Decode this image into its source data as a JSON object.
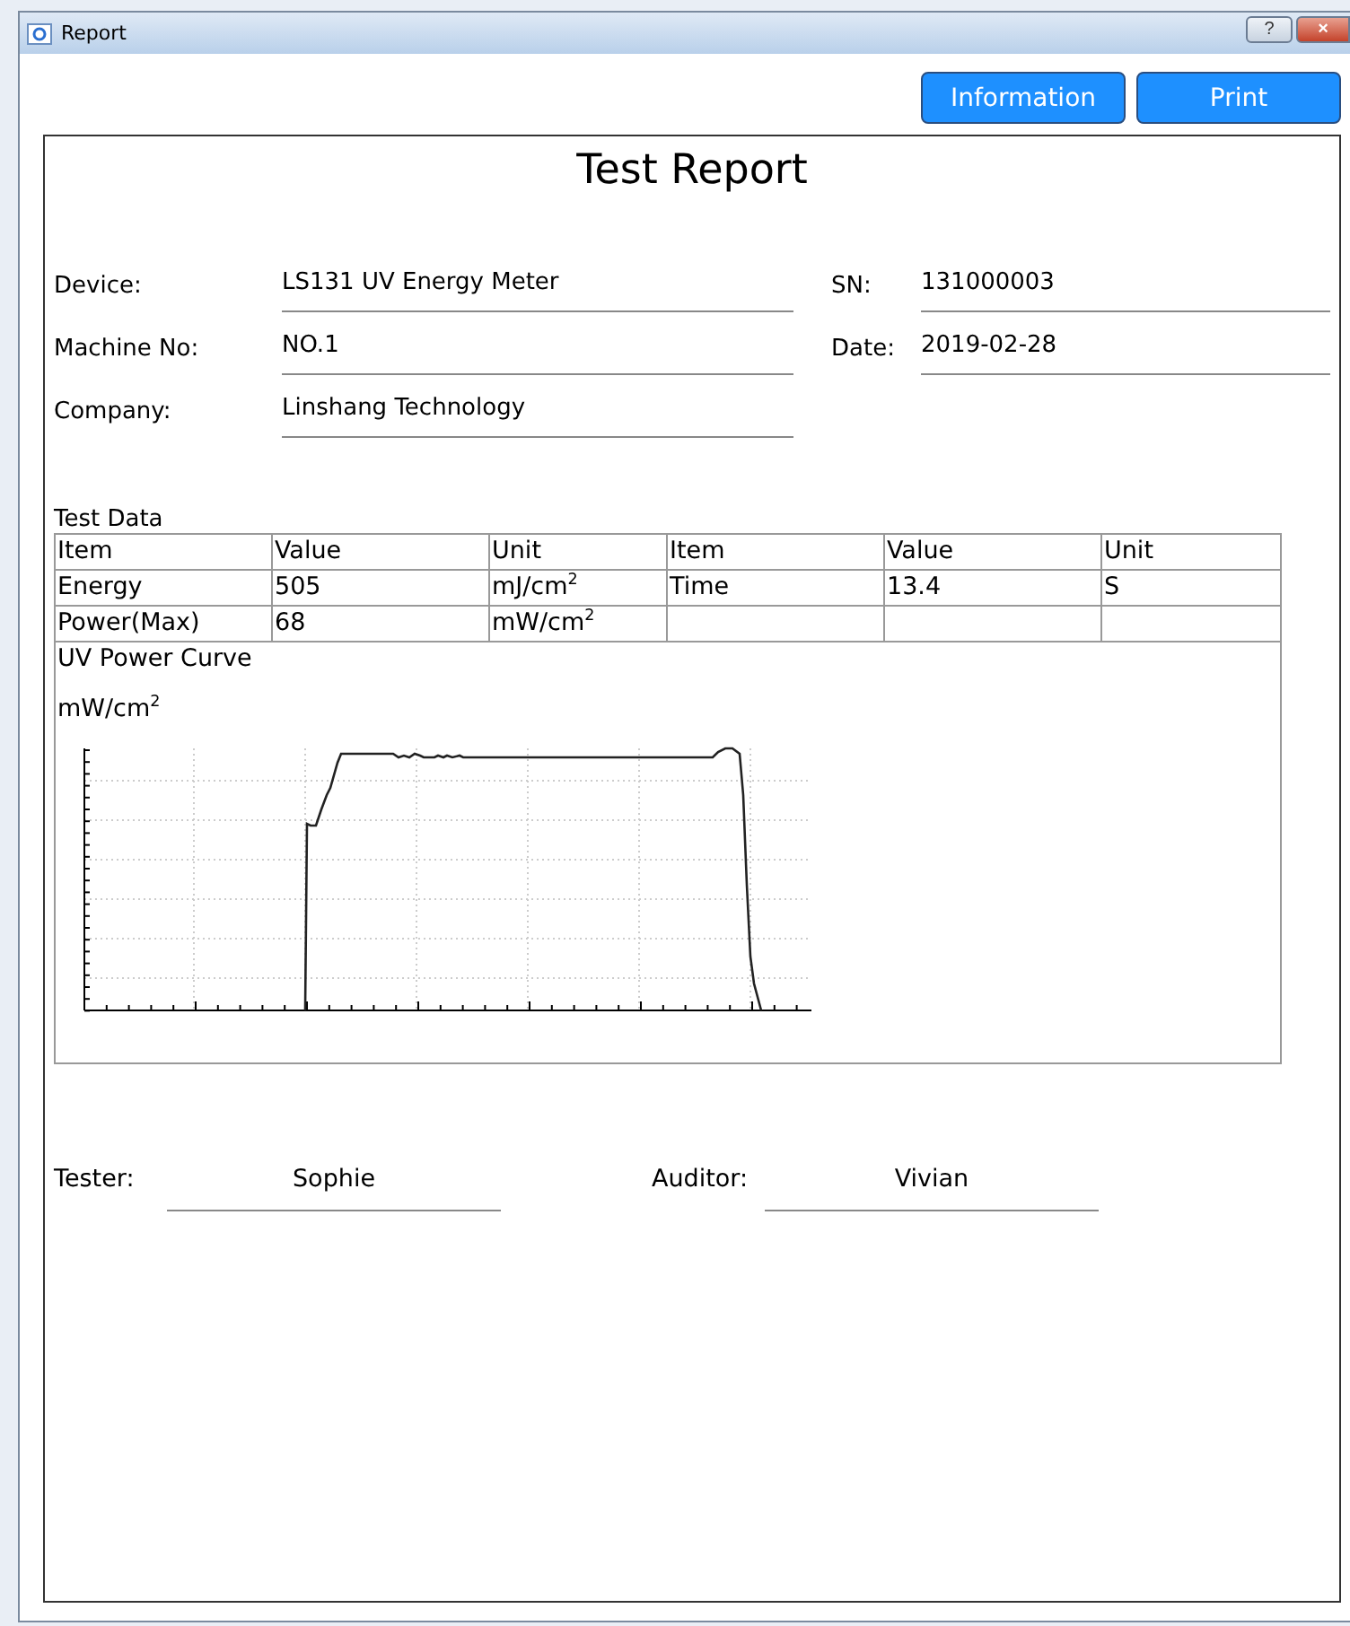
{
  "window": {
    "title": "Report"
  },
  "title_buttons": [
    {
      "kind": "help",
      "label": "?"
    },
    {
      "kind": "close",
      "label": "×"
    }
  ],
  "buttons": [
    "Information",
    "Print"
  ],
  "report": {
    "title": "Test Report",
    "fields_left": [
      {
        "label": "Device:",
        "value": "LS131 UV Energy Meter"
      },
      {
        "label": "Machine No:",
        "value": "NO.1"
      },
      {
        "label": "Company:",
        "value": "Linshang Technology"
      }
    ],
    "fields_right": [
      {
        "label": "SN:",
        "value": "131000003"
      },
      {
        "label": "Date:",
        "value": "2019-02-28"
      }
    ],
    "test_data": {
      "heading": "Test Data",
      "rows": [
        [
          "Item",
          "Value",
          "Unit",
          "Item",
          "Value",
          "Unit"
        ],
        [
          "Energy",
          "505",
          "mJ/cm$^{2}$",
          "Time",
          "13.4",
          "S"
        ],
        [
          "Power(Max)",
          "68",
          "mW/cm$^{2}$",
          "",
          "",
          ""
        ]
      ],
      "curve": {
        "title": "UV Power Curve",
        "unit": "mW/cm$^{2}$"
      }
    },
    "signatures": [
      {
        "label": "Tester:",
        "value": "Sophie"
      },
      {
        "label": "Auditor:",
        "value": "Vivian"
      }
    ]
  }
}
